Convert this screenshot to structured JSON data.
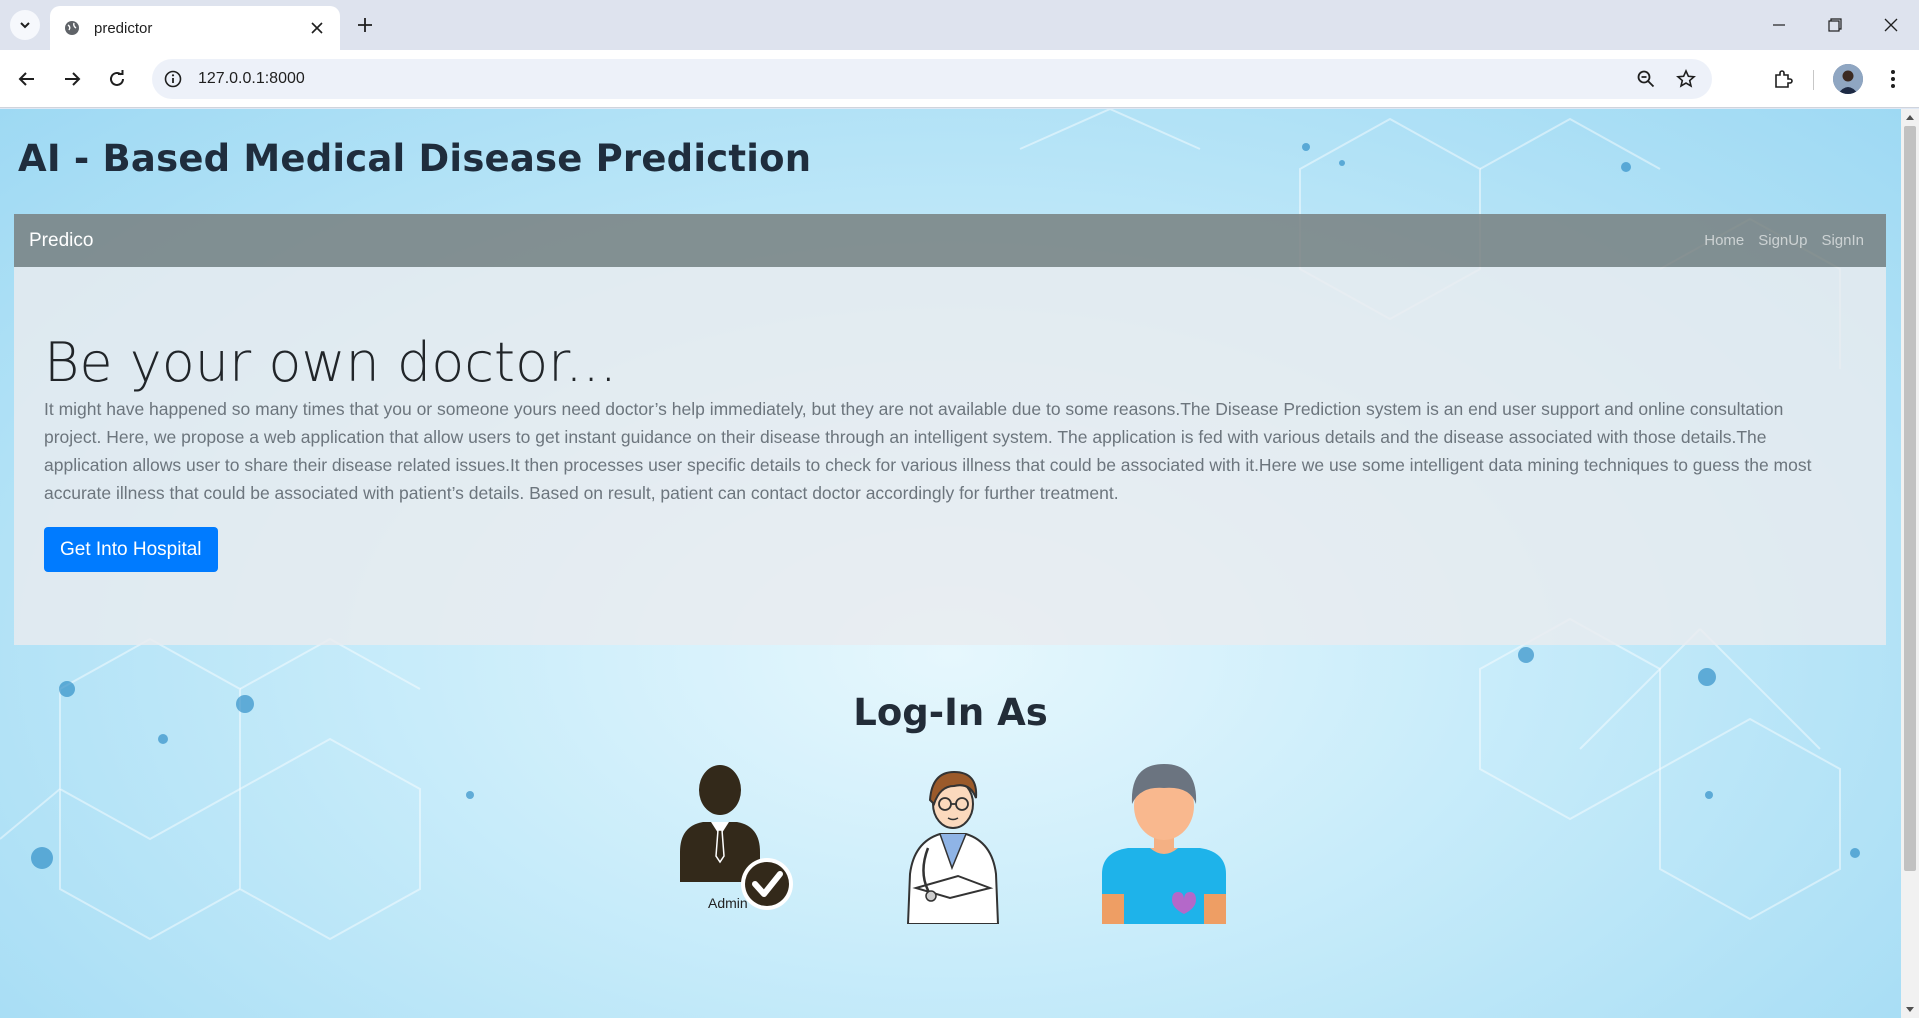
{
  "browser": {
    "tab_title": "predictor",
    "url": "127.0.0.1:8000"
  },
  "page": {
    "site_title": "AI - Based Medical Disease Prediction",
    "navbar": {
      "brand": "Predico",
      "links": [
        "Home",
        "SignUp",
        "SignIn"
      ]
    },
    "jumbotron": {
      "heading": "Be your own doctor...",
      "text": "It might have happened so many times that you or someone yours need doctor’s help immediately, but they are not available due to some reasons.The Disease Prediction system is an end user support and online consultation project. Here, we propose a web application that allow users to get instant guidance on their disease through an intelligent system. The application is fed with various details and the disease associated with those details.The application allows user to share their disease related issues.It then processes user specific details to check for various illness that could be associated with it.Here we use some intelligent data mining techniques to guess the most accurate illness that could be associated with patient’s details. Based on result, patient can contact doctor accordingly for further treatment.",
      "button_label": "Get Into Hospital"
    },
    "login": {
      "heading": "Log-In As",
      "admin_caption": "Admin"
    }
  },
  "colors": {
    "primary_button": "#007bff",
    "navbar_bg": "#7a8585",
    "title_text": "#1f2d3d"
  }
}
